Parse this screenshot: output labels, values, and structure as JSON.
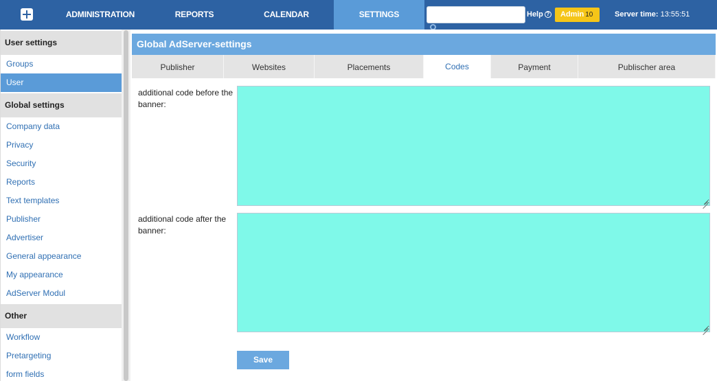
{
  "topnav": {
    "add_icon": "plus-icon",
    "items": [
      {
        "label": "ADMINISTRATION"
      },
      {
        "label": "REPORTS"
      },
      {
        "label": "CALENDAR"
      },
      {
        "label": "SETTINGS",
        "active": true
      }
    ],
    "search": {
      "value": "",
      "placeholder": ""
    },
    "help_label": "Help",
    "help_icon": "question-circle-icon",
    "admin_label": "Admin",
    "admin_count": "10",
    "server_time_label": "Server time:",
    "server_time_value": "13:55:51"
  },
  "sidebar": {
    "sections": [
      {
        "title": "User settings",
        "items": [
          {
            "label": "Groups"
          },
          {
            "label": "User",
            "active": true
          }
        ]
      },
      {
        "title": "Global settings",
        "items": [
          {
            "label": "Company data"
          },
          {
            "label": "Privacy"
          },
          {
            "label": "Security"
          },
          {
            "label": "Reports"
          },
          {
            "label": "Text templates"
          },
          {
            "label": "Publisher"
          },
          {
            "label": "Advertiser"
          },
          {
            "label": "General appearance"
          },
          {
            "label": "My appearance"
          },
          {
            "label": "AdServer Modul"
          }
        ]
      },
      {
        "title": "Other",
        "items": [
          {
            "label": "Workflow"
          },
          {
            "label": "Pretargeting"
          },
          {
            "label": "form fields"
          }
        ]
      }
    ]
  },
  "main": {
    "title": "Global AdServer-settings",
    "tabs": [
      {
        "label": "Publisher"
      },
      {
        "label": "Websites"
      },
      {
        "label": "Placements"
      },
      {
        "label": "Codes",
        "active": true
      },
      {
        "label": "Payment"
      },
      {
        "label": "Publischer area"
      }
    ],
    "fields": [
      {
        "label": "additional code before the banner:",
        "value": ""
      },
      {
        "label": "additional code after the banner:",
        "value": ""
      }
    ],
    "save_label": "Save"
  },
  "colors": {
    "topbar": "#2d62a3",
    "active_nav": "#5a9bd8",
    "panel_title": "#6ba8df",
    "textarea_bg": "#7ff9e9",
    "admin_badge": "#f5c518",
    "link": "#2f6fb3"
  }
}
